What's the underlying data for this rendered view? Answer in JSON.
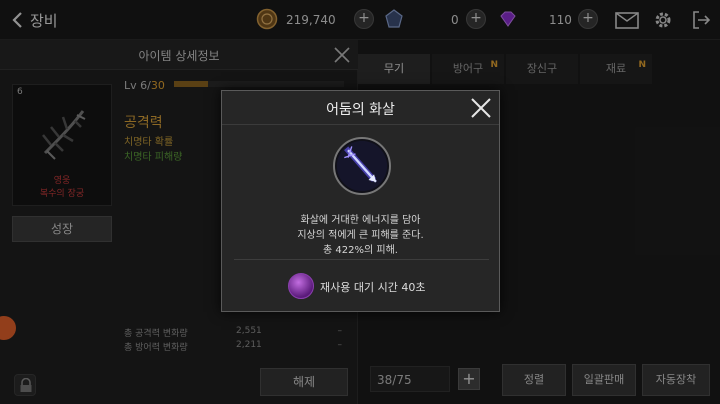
{
  "topbar": {
    "title": "장비",
    "gold": "219,740",
    "gem": "0",
    "diamond": "110"
  },
  "detail": {
    "header": "아이템 상세정보",
    "item_count": "6",
    "item_grade": "영웅",
    "item_name": "복수의 장궁",
    "grow_label": "성장",
    "lv_prefix": "Lv 6/",
    "lv_max": "30",
    "lv_progress": 0.2,
    "stat_title": "공격력",
    "stat_line1": "치명타 확률",
    "stat_line2": "치명타 피해량",
    "summary": [
      {
        "label": "총 공격력 변화량",
        "value": "2,551",
        "delta": "–"
      },
      {
        "label": "총 방어력 변화량",
        "value": "2,211",
        "delta": "–"
      }
    ],
    "release_label": "해제"
  },
  "tabs": [
    {
      "label": "무기",
      "badge": ""
    },
    {
      "label": "방어구",
      "badge": "N"
    },
    {
      "label": "장신구",
      "badge": ""
    },
    {
      "label": "재료",
      "badge": "N"
    }
  ],
  "inventory": {
    "count": "38/75",
    "sort_label": "정렬",
    "bulk_sell_label": "일괄판매",
    "auto_equip_label": "자동장착"
  },
  "modal": {
    "title": "어둠의 화살",
    "desc1": "화살에 거대한 에너지를 담아",
    "desc2": "지상의 적에게 큰 피해를 준다.",
    "desc3": "총 422%의 피해.",
    "cooldown": "재사용 대기 시간 40초"
  },
  "colors": {
    "accent_gold": "#e0a030",
    "grade_red": "#c93c3c",
    "crit_green": "#5b9b3a"
  }
}
